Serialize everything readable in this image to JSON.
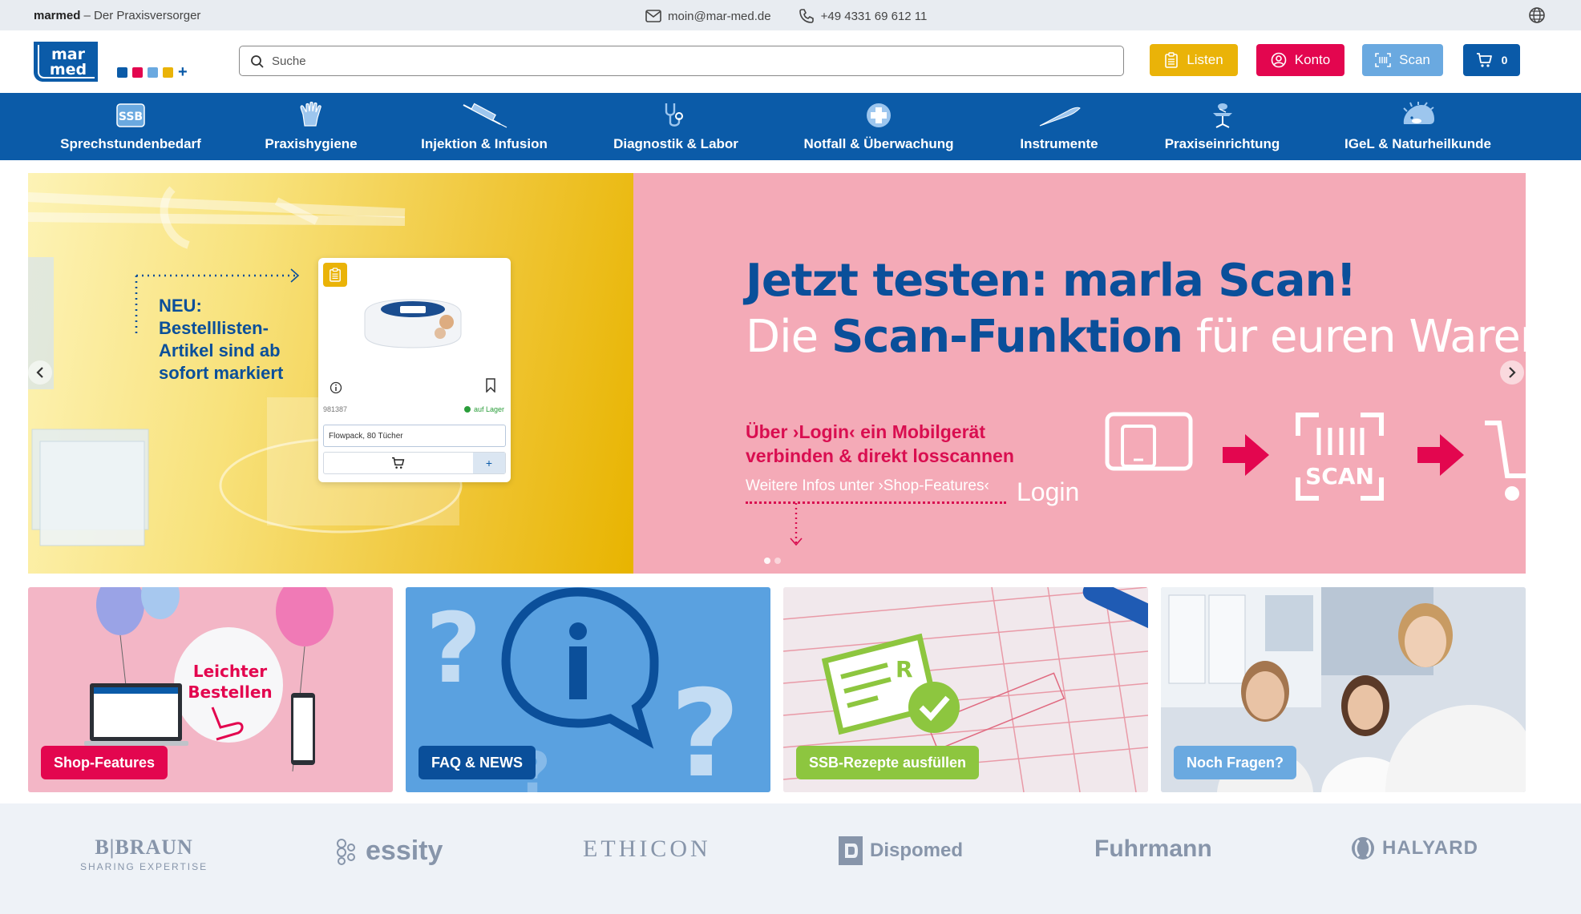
{
  "topbar": {
    "brand_name": "marmed",
    "brand_tagline": "– Der Praxisversorger",
    "email": "moin@mar-med.de",
    "phone": "+49 4331 69 612 11"
  },
  "header": {
    "logo_line1": "mar",
    "logo_line2": "med",
    "search_placeholder": "Suche",
    "listen_label": "Listen",
    "konto_label": "Konto",
    "scan_label": "Scan",
    "cart_count": "0"
  },
  "nav": {
    "items": [
      {
        "label": "Sprechstundenbedarf",
        "icon": "ssb-icon"
      },
      {
        "label": "Praxishygiene",
        "icon": "glove-icon"
      },
      {
        "label": "Injektion & Infusion",
        "icon": "syringe-icon"
      },
      {
        "label": "Diagnostik & Labor",
        "icon": "stethoscope-icon"
      },
      {
        "label": "Notfall & Überwachung",
        "icon": "medical-cross-icon"
      },
      {
        "label": "Instrumente",
        "icon": "scalpel-icon"
      },
      {
        "label": "Praxiseinrichtung",
        "icon": "exam-chair-icon"
      },
      {
        "label": "IGeL & Naturheilkunde",
        "icon": "hedgehog-icon"
      }
    ]
  },
  "hero": {
    "slide1": {
      "neu_line1": "NEU:",
      "neu_line2": "Bestelllisten-",
      "neu_line3": "Artikel sind ab",
      "neu_line4": "sofort markiert",
      "card_article_no": "981387",
      "card_stock": "auf Lager",
      "card_variant": "Flowpack, 80 Tücher"
    },
    "slide2": {
      "title_line1": "Jetzt testen: marla Scan!",
      "title_line2_pre": "Die ",
      "title_line2_bold": "Scan-Funktion",
      "title_line2_post": " für euren Warenko",
      "sub_line1": "Über ›Login‹ ein Mobilgerät",
      "sub_line2": "verbinden & direkt losscannen",
      "link_text": "Weitere Infos unter ›Shop-Features‹",
      "login_label": "Login",
      "scan_label": "SCAN"
    }
  },
  "tiles": [
    {
      "label": "Shop-Features",
      "balloon_text_1": "Leichter",
      "balloon_text_2": "Bestellen",
      "color": "#e3064f"
    },
    {
      "label": "FAQ & NEWS",
      "color": "#0a4f9a"
    },
    {
      "label": "SSB-Rezepte ausfüllen",
      "color": "#8dc63f"
    },
    {
      "label": "Noch Fragen?",
      "color": "#6aa9e0"
    }
  ],
  "brands": {
    "items": [
      "B|BRAUN",
      "SHARING EXPERTISE",
      "essity",
      "ETHICON",
      "Dispomed",
      "Fuhrmann",
      "HALYARD"
    ]
  },
  "colors": {
    "primary": "#0b5ba8",
    "magenta": "#e3064f",
    "yellow": "#eab308",
    "light_blue": "#6aa9e0",
    "green": "#8dc63f"
  }
}
